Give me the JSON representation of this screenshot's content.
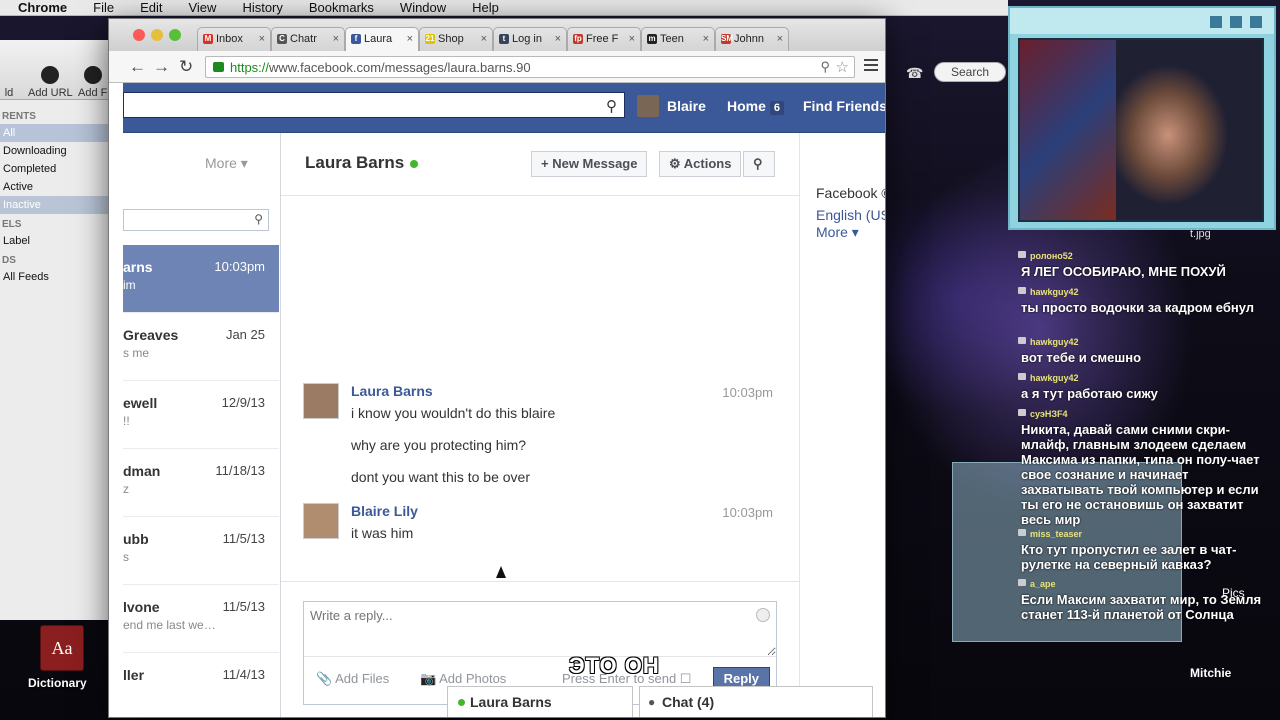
{
  "menubar": {
    "app_name": "Chrome",
    "items": [
      "File",
      "Edit",
      "View",
      "History",
      "Bookmarks",
      "Window",
      "Help"
    ]
  },
  "bg_app": {
    "toolbar": [
      "Add URL",
      "Add F"
    ],
    "toolbar_left_cut": "ld",
    "sections": {
      "torrents": "RENTS",
      "labels": "ELS",
      "feeds": "DS"
    },
    "rows": [
      "All",
      "Downloading",
      "Completed",
      "Active",
      "Inactive",
      "Label",
      "All Feeds"
    ]
  },
  "dock_icon": {
    "label": "Dictionary",
    "glyph": "Aa"
  },
  "browser": {
    "tabs": [
      {
        "label": "Inbox",
        "color": "#d93025",
        "glyph": "M"
      },
      {
        "label": "Chatr",
        "color": "#555",
        "glyph": "C"
      },
      {
        "label": "Laura",
        "color": "#3b5998",
        "glyph": "f"
      },
      {
        "label": "Shop",
        "color": "#e0c400",
        "glyph": "21"
      },
      {
        "label": "Log in",
        "color": "#35465c",
        "glyph": "t"
      },
      {
        "label": "Free F",
        "color": "#c0392b",
        "glyph": "fp"
      },
      {
        "label": "Teen",
        "color": "#222",
        "glyph": "m"
      },
      {
        "label": "Johnn",
        "color": "#c0392b",
        "glyph": "SM"
      }
    ],
    "close_glyph": "×",
    "url_scheme": "https://",
    "url_rest": "www.facebook.com/messages/laura.barns.90"
  },
  "fb": {
    "user_name": "Blaire",
    "home_label": "Home",
    "home_count": "6",
    "find_friends": "Find Friends",
    "more_label": "More",
    "conversations": [
      {
        "name": "arns",
        "date": "10:03pm",
        "preview": "im",
        "selected": true
      },
      {
        "name": "Greaves",
        "date": "Jan 25",
        "preview": "s me"
      },
      {
        "name": "ewell",
        "date": "12/9/13",
        "preview": "!!"
      },
      {
        "name": "dman",
        "date": "11/18/13",
        "preview": "z"
      },
      {
        "name": "ubb",
        "date": "11/5/13",
        "preview": "s"
      },
      {
        "name": "lvone",
        "date": "11/5/13",
        "preview": "end me last we…"
      },
      {
        "name": "ller",
        "date": "11/4/13",
        "preview": ""
      }
    ],
    "thread_title": "Laura Barns",
    "new_message": "New Message",
    "actions": "Actions",
    "messages": [
      {
        "sender": "Laura Barns",
        "time": "10:03pm",
        "lines": [
          "i know you wouldn't do this blaire",
          "why are you protecting him?",
          "dont you want this to be over"
        ]
      },
      {
        "sender": "Blaire Lily",
        "time": "10:03pm",
        "lines": [
          "it was him"
        ]
      }
    ],
    "reply_placeholder": "Write a reply...",
    "add_files": "Add Files",
    "add_photos": "Add Photos",
    "press_enter": "Press Enter to send",
    "reply_button": "Reply",
    "right_links": [
      "Facebook ©",
      "English (US",
      "More"
    ],
    "dock": [
      {
        "label": "Laura Barns"
      },
      {
        "label": "Chat (4)"
      }
    ]
  },
  "subtitle": "ЭТО ОН",
  "desktop": {
    "finder_search": "Search",
    "pics": "Pics",
    "mitchie": "Mitchie",
    "jpg": "t.jpg"
  },
  "twitch_chat": [
    {
      "user": "ролоно52",
      "text": "Я ЛЕГ ОСОБИРАЮ, МНЕ ПОХУЙ"
    },
    {
      "user": "hawkguy42",
      "text": "ты просто водочки за кадром ебнул"
    },
    {
      "user": "hawkguy42",
      "text": "вот тебе и смешно"
    },
    {
      "user": "hawkguy42",
      "text": "а я тут работаю сижу"
    },
    {
      "user": "суэНЗF4",
      "text": "Никита, давай сами сними скри-млайф, главным злодеем сделаем Максима из папки, типа он полу-чает свое сознание и начинает захватывать твой компьютер и если ты его не остановишь он захватит весь мир"
    },
    {
      "user": "miss_teaser",
      "text": "Кто тут пропустил ее залет в чат-рулетке на северный кавказ?"
    },
    {
      "user": "a_ape",
      "text": "Если Максим захватит мир, то Земля станет 113-й планетой от Солнца"
    }
  ]
}
